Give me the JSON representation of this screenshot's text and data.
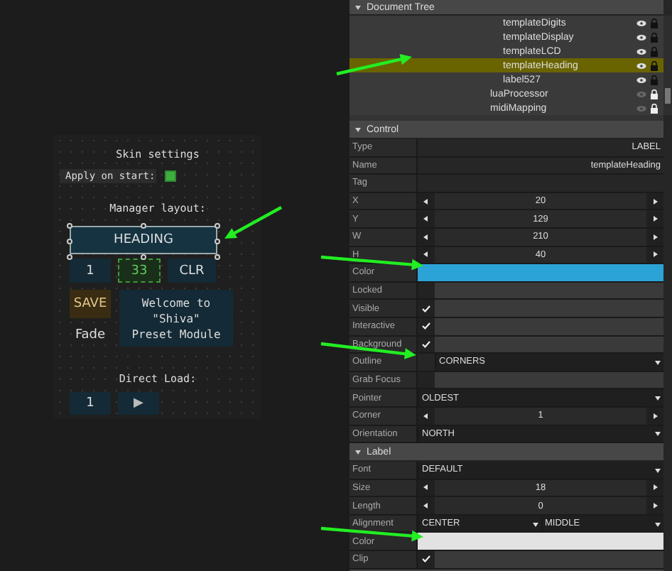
{
  "canvas": {
    "title": "Skin settings",
    "apply": {
      "label": "Apply on start:",
      "checked": true
    },
    "layout_label": "Manager layout:",
    "heading": {
      "text": "HEADING",
      "selected": true
    },
    "row": [
      {
        "text": "1",
        "kind": "button"
      },
      {
        "text": "33",
        "kind": "display"
      },
      {
        "text": "CLR",
        "kind": "button"
      }
    ],
    "save": "SAVE",
    "fade": "Fade",
    "welcome": "Welcome to\n\"Shiva\"\nPreset Module",
    "direct_label": "Direct Load:",
    "direct": [
      {
        "text": "1"
      },
      {
        "text": "▶"
      }
    ]
  },
  "tree": {
    "title": "Document Tree",
    "items": [
      {
        "children": [
          {
            "label": "templateDigits",
            "selected": false,
            "visible": true,
            "locked": true
          },
          {
            "label": "templateDisplay",
            "selected": false,
            "visible": true,
            "locked": true
          },
          {
            "label": "templateLCD",
            "selected": false,
            "visible": true,
            "locked": true
          },
          {
            "label": "templateHeading",
            "selected": true,
            "visible": true,
            "locked": true
          },
          {
            "label": "label527",
            "selected": false,
            "visible": true,
            "locked": true
          }
        ]
      },
      {
        "label": "luaProcessor",
        "selected": false,
        "visible": false,
        "locked": false
      },
      {
        "label": "midiMapping",
        "selected": false,
        "visible": false,
        "locked": false
      }
    ]
  },
  "sections": [
    {
      "title": "Control",
      "rows": [
        {
          "label": "Type",
          "kind": "text",
          "value": "LABEL"
        },
        {
          "label": "Name",
          "kind": "text",
          "value": "templateHeading"
        },
        {
          "label": "Tag",
          "kind": "text"
        },
        {
          "label": "X",
          "kind": "stepper",
          "value": "20"
        },
        {
          "label": "Y",
          "kind": "stepper",
          "value": "129"
        },
        {
          "label": "W",
          "kind": "stepper",
          "value": "210"
        },
        {
          "label": "H",
          "kind": "stepper",
          "value": "40"
        },
        {
          "label": "Color",
          "kind": "color",
          "color": "#2ba3d6"
        },
        {
          "label": "Locked",
          "kind": "check",
          "checked": false
        },
        {
          "label": "Visible",
          "kind": "check",
          "checked": true
        },
        {
          "label": "Interactive",
          "kind": "check",
          "checked": true
        },
        {
          "label": "Background",
          "kind": "check",
          "checked": true
        },
        {
          "label": "Outline",
          "kind": "offset-dropdown",
          "value": "CORNERS"
        },
        {
          "label": "Grab Focus",
          "kind": "check",
          "checked": false
        },
        {
          "label": "Pointer",
          "kind": "dropdown",
          "value": "OLDEST"
        },
        {
          "label": "Corner",
          "kind": "stepper",
          "value": "1"
        },
        {
          "label": "Orientation",
          "kind": "dropdown",
          "value": "NORTH"
        }
      ]
    },
    {
      "title": "Label",
      "rows": [
        {
          "label": "Font",
          "kind": "dropdown",
          "value": "DEFAULT"
        },
        {
          "label": "Size",
          "kind": "stepper",
          "value": "18"
        },
        {
          "label": "Length",
          "kind": "stepper",
          "value": "0"
        },
        {
          "label": "Alignment",
          "kind": "double-dropdown",
          "value": "CENTER",
          "value2": "MIDDLE"
        },
        {
          "label": "Color",
          "kind": "color",
          "color": "#e2e2e2"
        },
        {
          "label": "Clip",
          "kind": "check",
          "checked": true
        }
      ]
    }
  ]
}
